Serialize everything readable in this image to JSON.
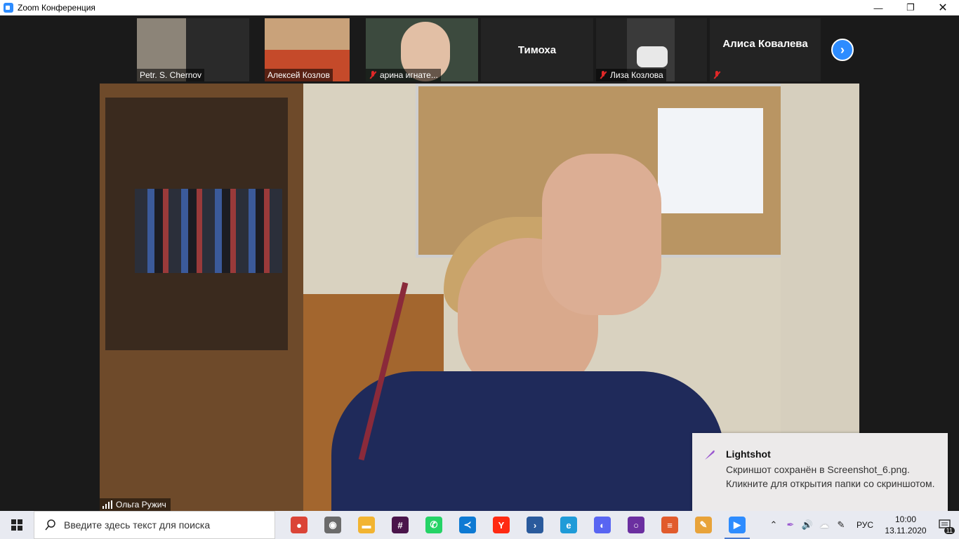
{
  "window": {
    "title": "Zoom Конференция"
  },
  "thumbnails": [
    {
      "name": "Petr. S. Chernov",
      "muted": false,
      "video": true
    },
    {
      "name": "Алексей Козлов",
      "muted": false,
      "video": true
    },
    {
      "name": "арина игнате...",
      "muted": true,
      "video": true
    },
    {
      "name": "Тимоха",
      "muted": false,
      "video": false
    },
    {
      "name": "Лиза Козлова",
      "muted": true,
      "video": true
    },
    {
      "name": "Алиса Ковалева",
      "muted": true,
      "video": false
    }
  ],
  "main_speaker": {
    "name": "Ольга Ружич"
  },
  "toast": {
    "app": "Lightshot",
    "message": "Скриншот сохранён в Screenshot_6.png. Кликните для открытия папки со скриншотом."
  },
  "taskbar": {
    "search_placeholder": "Введите здесь текст для поиска",
    "apps": [
      {
        "icon": "chrome-icon",
        "color": "#db4437",
        "glyph": "●"
      },
      {
        "icon": "camera-app-icon",
        "color": "#6b6b6b",
        "glyph": "◉"
      },
      {
        "icon": "file-explorer-icon",
        "color": "#f2b431",
        "glyph": "▬"
      },
      {
        "icon": "slack-icon",
        "color": "#4a154b",
        "glyph": "#"
      },
      {
        "icon": "whatsapp-icon",
        "color": "#25d366",
        "glyph": "✆"
      },
      {
        "icon": "vscode-icon",
        "color": "#0e7ad3",
        "glyph": "≺"
      },
      {
        "icon": "yandex-browser-icon",
        "color": "#ff2a12",
        "glyph": "Y"
      },
      {
        "icon": "powershell-icon",
        "color": "#2a5a9c",
        "glyph": "›"
      },
      {
        "icon": "edge-icon",
        "color": "#1f9bd8",
        "glyph": "e"
      },
      {
        "icon": "discord-icon",
        "color": "#5865f2",
        "glyph": "◐"
      },
      {
        "icon": "obs-icon",
        "color": "#6b2fa0",
        "glyph": "○"
      },
      {
        "icon": "document-app-icon",
        "color": "#e15b2c",
        "glyph": "≡"
      },
      {
        "icon": "paint-icon",
        "color": "#e8a33a",
        "glyph": "✎"
      },
      {
        "icon": "zoom-icon",
        "color": "#2d8cff",
        "glyph": "▶"
      }
    ],
    "language": "РУС",
    "time": "10:00",
    "date": "13.11.2020",
    "notification_count": "11"
  }
}
